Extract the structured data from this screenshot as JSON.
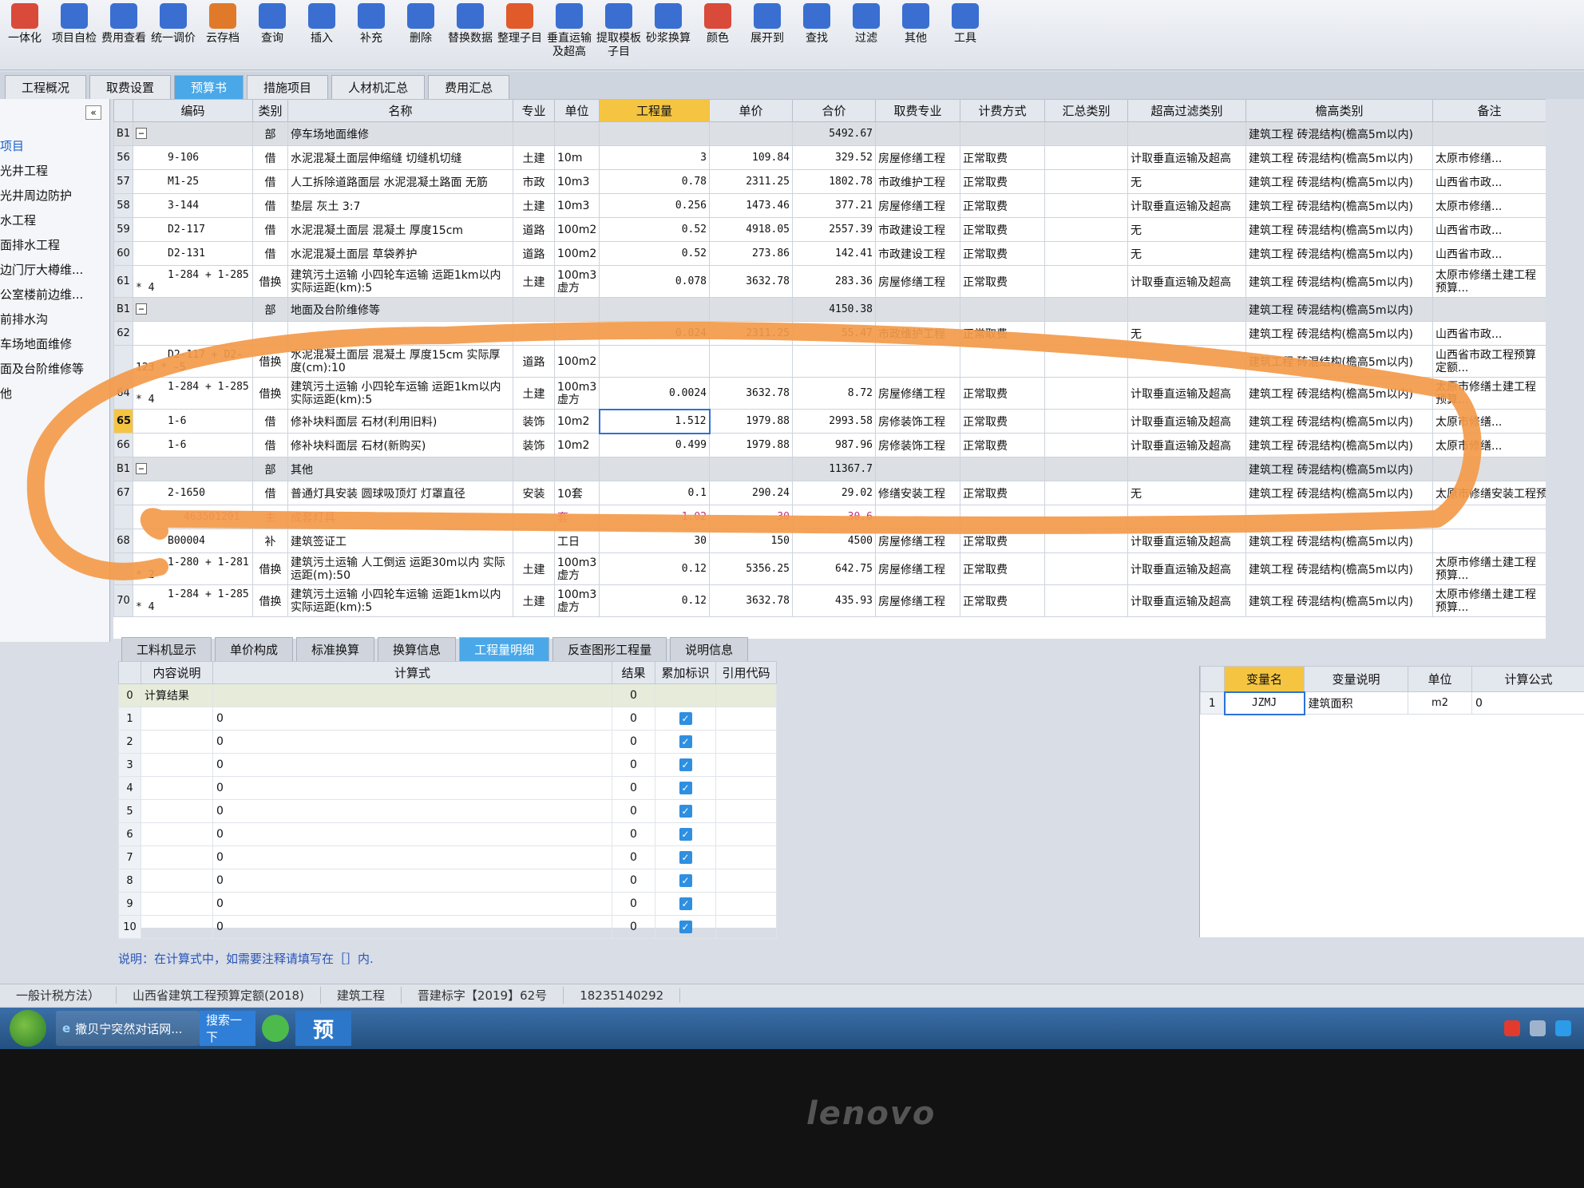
{
  "toolbar": {
    "buttons": [
      {
        "label": "一体化",
        "icon": "integration-icon",
        "color": "#d94a3a"
      },
      {
        "label": "项目自检",
        "icon": "project-check-icon",
        "color": "#3a6fd1"
      },
      {
        "label": "费用查看",
        "icon": "cost-view-icon",
        "color": "#3a6fd1"
      },
      {
        "label": "统一调价",
        "icon": "price-adjust-icon",
        "color": "#3a6fd1"
      },
      {
        "label": "云存档",
        "icon": "cloud-save-icon",
        "color": "#e07a2a"
      },
      {
        "label": "查询",
        "icon": "query-icon",
        "color": "#3a6fd1"
      },
      {
        "label": "插入",
        "icon": "insert-icon",
        "color": "#3a6fd1"
      },
      {
        "label": "补充",
        "icon": "supplement-icon",
        "color": "#3a6fd1"
      },
      {
        "label": "删除",
        "icon": "delete-icon",
        "color": "#3a6fd1"
      },
      {
        "label": "替换数据",
        "icon": "replace-data-icon",
        "color": "#3a6fd1"
      },
      {
        "label": "整理子目",
        "icon": "organize-icon",
        "color": "#e05a2a"
      },
      {
        "label": "垂直运输\n及超高",
        "icon": "vertical-transport-icon",
        "color": "#3a6fd1"
      },
      {
        "label": "提取模板\n子目",
        "icon": "template-icon",
        "color": "#3a6fd1"
      },
      {
        "label": "砂浆换算",
        "icon": "mortar-icon",
        "color": "#3a6fd1"
      },
      {
        "label": "颜色",
        "icon": "color-icon",
        "color": "#d94a3a"
      },
      {
        "label": "展开到",
        "icon": "expand-icon",
        "color": "#3a6fd1"
      },
      {
        "label": "查找",
        "icon": "find-icon",
        "color": "#3a6fd1"
      },
      {
        "label": "过滤",
        "icon": "filter-icon",
        "color": "#3a6fd1"
      },
      {
        "label": "其他",
        "icon": "other-icon",
        "color": "#3a6fd1"
      },
      {
        "label": "工具",
        "icon": "tools-icon",
        "color": "#3a6fd1"
      }
    ]
  },
  "main_tabs": [
    "工程概况",
    "取费设置",
    "预算书",
    "措施项目",
    "人材机汇总",
    "费用汇总"
  ],
  "left_tree": {
    "collapse_label": "«",
    "items": [
      "项目",
      "光井工程",
      "光井周边防护",
      "水工程",
      "面排水工程",
      "边门厅大樽维...",
      "公室楼前边维...",
      "前排水沟",
      "车场地面维修",
      "面及台阶维修等",
      "他"
    ]
  },
  "grid": {
    "headers": [
      "编码",
      "类别",
      "名称",
      "专业",
      "单位",
      "工程量",
      "单价",
      "合价",
      "取费专业",
      "计费方式",
      "汇总类别",
      "超高过滤类别",
      "檐高类别",
      "备注"
    ],
    "rows": [
      {
        "idx": "B1",
        "section": true,
        "code": "",
        "type": "部",
        "name": "停车场地面维修",
        "major": "",
        "unit": "",
        "qty": "",
        "price": "",
        "total": "5492.67",
        "fee": "",
        "method": "",
        "sum": "",
        "filter": "",
        "height": "建筑工程 砖混结构(檐高5m以内)",
        "remark": ""
      },
      {
        "idx": "56",
        "code": "9-106",
        "type": "借",
        "name": "水泥混凝土面层伸缩缝 切缝机切缝",
        "major": "土建",
        "unit": "10m",
        "qty": "3",
        "price": "109.84",
        "total": "329.52",
        "fee": "房屋修缮工程",
        "method": "正常取费",
        "sum": "",
        "filter": "计取垂直运输及超高",
        "height": "建筑工程 砖混结构(檐高5m以内)",
        "remark": "太原市修缮..."
      },
      {
        "idx": "57",
        "code": "M1-25",
        "type": "借",
        "name": "人工拆除道路面层 水泥混凝土路面 无筋",
        "major": "市政",
        "unit": "10m3",
        "qty": "0.78",
        "price": "2311.25",
        "total": "1802.78",
        "fee": "市政维护工程",
        "method": "正常取费",
        "sum": "",
        "filter": "无",
        "height": "建筑工程 砖混结构(檐高5m以内)",
        "remark": "山西省市政..."
      },
      {
        "idx": "58",
        "code": "3-144",
        "type": "借",
        "name": "垫层 灰土 3:7",
        "major": "土建",
        "unit": "10m3",
        "qty": "0.256",
        "price": "1473.46",
        "total": "377.21",
        "fee": "房屋修缮工程",
        "method": "正常取费",
        "sum": "",
        "filter": "计取垂直运输及超高",
        "height": "建筑工程 砖混结构(檐高5m以内)",
        "remark": "太原市修缮..."
      },
      {
        "idx": "59",
        "code": "D2-117",
        "type": "借",
        "name": "水泥混凝土面层 混凝土 厚度15cm",
        "major": "道路",
        "unit": "100m2",
        "qty": "0.52",
        "price": "4918.05",
        "total": "2557.39",
        "fee": "市政建设工程",
        "method": "正常取费",
        "sum": "",
        "filter": "无",
        "height": "建筑工程 砖混结构(檐高5m以内)",
        "remark": "山西省市政..."
      },
      {
        "idx": "60",
        "code": "D2-131",
        "type": "借",
        "name": "水泥混凝土面层 草袋养护",
        "major": "道路",
        "unit": "100m2",
        "qty": "0.52",
        "price": "273.86",
        "total": "142.41",
        "fee": "市政建设工程",
        "method": "正常取费",
        "sum": "",
        "filter": "无",
        "height": "建筑工程 砖混结构(檐高5m以内)",
        "remark": "山西省市政..."
      },
      {
        "idx": "61",
        "tall": true,
        "code": "1-284 + 1-285 * 4",
        "type": "借换",
        "name": "建筑污土运输 小四轮车运输 运距1km以内 实际运距(km):5",
        "major": "土建",
        "unit": "100m3 虚方",
        "qty": "0.078",
        "price": "3632.78",
        "total": "283.36",
        "fee": "房屋修缮工程",
        "method": "正常取费",
        "sum": "",
        "filter": "计取垂直运输及超高",
        "height": "建筑工程 砖混结构(檐高5m以内)",
        "remark": "太原市修缮土建工程预算..."
      },
      {
        "idx": "B1",
        "section": true,
        "code": "",
        "type": "部",
        "name": "地面及台阶维修等",
        "major": "",
        "unit": "",
        "qty": "",
        "price": "",
        "total": "4150.38",
        "fee": "",
        "method": "",
        "sum": "",
        "filter": "",
        "height": "建筑工程 砖混结构(檐高5m以内)",
        "remark": ""
      },
      {
        "idx": "62",
        "code": "",
        "type": "",
        "name": "",
        "major": "",
        "unit": "",
        "qty": "0.024",
        "price": "2311.25",
        "total": "55.47",
        "fee": "市政维护工程",
        "method": "正常取费",
        "sum": "",
        "filter": "无",
        "height": "建筑工程 砖混结构(檐高5m以内)",
        "remark": "山西省市政..."
      },
      {
        "idx": "",
        "tall": true,
        "code": "D2-117 + D2-123 * -5",
        "type": "借换",
        "name": "水泥混凝土面层 混凝土 厚度15cm 实际厚度(cm):10",
        "major": "道路",
        "unit": "100m2",
        "qty": "",
        "price": "",
        "total": "",
        "fee": "",
        "method": "",
        "sum": "",
        "filter": "",
        "height": "建筑工程 砖混结构(檐高5m以内)",
        "remark": "山西省市政工程预算定额..."
      },
      {
        "idx": "64",
        "tall": true,
        "code": "1-284 + 1-285 * 4",
        "type": "借换",
        "name": "建筑污土运输 小四轮车运输 运距1km以内 实际运距(km):5",
        "major": "土建",
        "unit": "100m3 虚方",
        "qty": "0.0024",
        "price": "3632.78",
        "total": "8.72",
        "fee": "房屋修缮工程",
        "method": "正常取费",
        "sum": "",
        "filter": "计取垂直运输及超高",
        "height": "建筑工程 砖混结构(檐高5m以内)",
        "remark": "太原市修缮土建工程预算..."
      },
      {
        "idx": "65",
        "selected": true,
        "code": "1-6",
        "type": "借",
        "name": "修补块料面层 石材(利用旧料)",
        "major": "装饰",
        "unit": "10m2",
        "qty": "1.512",
        "price": "1979.88",
        "total": "2993.58",
        "fee": "房修装饰工程",
        "method": "正常取费",
        "sum": "",
        "filter": "计取垂直运输及超高",
        "height": "建筑工程 砖混结构(檐高5m以内)",
        "remark": "太原市修缮..."
      },
      {
        "idx": "66",
        "code": "1-6",
        "type": "借",
        "name": "修补块料面层 石材(新购买)",
        "major": "装饰",
        "unit": "10m2",
        "qty": "0.499",
        "price": "1979.88",
        "total": "987.96",
        "fee": "房修装饰工程",
        "method": "正常取费",
        "sum": "",
        "filter": "计取垂直运输及超高",
        "height": "建筑工程 砖混结构(檐高5m以内)",
        "remark": "太原市修缮..."
      },
      {
        "idx": "B1",
        "section": true,
        "code": "",
        "type": "部",
        "name": "其他",
        "major": "",
        "unit": "",
        "qty": "",
        "price": "",
        "total": "11367.7",
        "fee": "",
        "method": "",
        "sum": "",
        "filter": "",
        "height": "建筑工程 砖混结构(檐高5m以内)",
        "remark": ""
      },
      {
        "idx": "67",
        "code": "2-1650",
        "type": "借",
        "name": "普通灯具安装 圆球吸顶灯 灯罩直径",
        "major": "安装",
        "unit": "10套",
        "qty": "0.1",
        "price": "290.24",
        "total": "29.02",
        "fee": "修缮安装工程",
        "method": "正常取费",
        "sum": "",
        "filter": "无",
        "height": "建筑工程 砖混结构(檐高5m以内)",
        "remark": "太原市修缮安装工程预算..."
      },
      {
        "idx": "",
        "sub": true,
        "code": "463501201",
        "type": "主",
        "name": "成套灯具",
        "major": "",
        "unit": "套",
        "qty": "1.02",
        "price": "30",
        "total": "30.6",
        "fee": "",
        "method": "",
        "sum": "",
        "filter": "",
        "height": "",
        "remark": ""
      },
      {
        "idx": "68",
        "code": "B00004",
        "type": "补",
        "name": "建筑签证工",
        "major": "",
        "unit": "工日",
        "qty": "30",
        "price": "150",
        "total": "4500",
        "fee": "房屋修缮工程",
        "method": "正常取费",
        "sum": "",
        "filter": "计取垂直运输及超高",
        "height": "建筑工程 砖混结构(檐高5m以内)",
        "remark": ""
      },
      {
        "idx": "",
        "tall": true,
        "code": "1-280 + 1-281 * 2",
        "type": "借换",
        "name": "建筑污土运输 人工倒运 运距30m以内 实际运距(m):50",
        "major": "土建",
        "unit": "100m3 虚方",
        "qty": "0.12",
        "price": "5356.25",
        "total": "642.75",
        "fee": "房屋修缮工程",
        "method": "正常取费",
        "sum": "",
        "filter": "计取垂直运输及超高",
        "height": "建筑工程 砖混结构(檐高5m以内)",
        "remark": "太原市修缮土建工程预算..."
      },
      {
        "idx": "70",
        "tall": true,
        "code": "1-284 + 1-285 * 4",
        "type": "借换",
        "name": "建筑污土运输 小四轮车运输 运距1km以内 实际运距(km):5",
        "major": "土建",
        "unit": "100m3 虚方",
        "qty": "0.12",
        "price": "3632.78",
        "total": "435.93",
        "fee": "房屋修缮工程",
        "method": "正常取费",
        "sum": "",
        "filter": "计取垂直运输及超高",
        "height": "建筑工程 砖混结构(檐高5m以内)",
        "remark": "太原市修缮土建工程预算..."
      }
    ]
  },
  "bottom_tabs": [
    "工料机显示",
    "单价构成",
    "标准换算",
    "换算信息",
    "工程量明细",
    "反查图形工程量",
    "说明信息"
  ],
  "calc_grid": {
    "headers": [
      "内容说明",
      "计算式",
      "结果",
      "累加标识",
      "引用代码"
    ],
    "rows": [
      {
        "idx": "0",
        "desc": "计算结果",
        "formula": "",
        "result": "0",
        "check": false
      },
      {
        "idx": "1",
        "desc": "",
        "formula": "0",
        "result": "0",
        "check": true
      },
      {
        "idx": "2",
        "desc": "",
        "formula": "0",
        "result": "0",
        "check": true
      },
      {
        "idx": "3",
        "desc": "",
        "formula": "0",
        "result": "0",
        "check": true
      },
      {
        "idx": "4",
        "desc": "",
        "formula": "0",
        "result": "0",
        "check": true
      },
      {
        "idx": "5",
        "desc": "",
        "formula": "0",
        "result": "0",
        "check": true
      },
      {
        "idx": "6",
        "desc": "",
        "formula": "0",
        "result": "0",
        "check": true
      },
      {
        "idx": "7",
        "desc": "",
        "formula": "0",
        "result": "0",
        "check": true
      },
      {
        "idx": "8",
        "desc": "",
        "formula": "0",
        "result": "0",
        "check": true
      },
      {
        "idx": "9",
        "desc": "",
        "formula": "0",
        "result": "0",
        "check": true
      },
      {
        "idx": "10",
        "desc": "",
        "formula": "0",
        "result": "0",
        "check": true
      }
    ],
    "note": "说明：在计算式中，如需要注释请填写在［］内."
  },
  "vars_grid": {
    "headers": [
      "变量名",
      "变量说明",
      "单位",
      "计算公式"
    ],
    "rows": [
      {
        "idx": "1",
        "name": "JZMJ",
        "desc": "建筑面积",
        "unit": "m2",
        "formula": "0"
      }
    ]
  },
  "status": {
    "items": [
      "一般计税方法）",
      "山西省建筑工程预算定额(2018)",
      "建筑工程",
      "晋建标字【2019】62号",
      "18235140292"
    ]
  },
  "taskbar": {
    "ie_label": "撒贝宁突然对话网...",
    "search_label": "搜索一下",
    "app_label": "预"
  },
  "monitor": {
    "brand": "lenovo"
  },
  "colors": {
    "accent_tab": "#4aa8e8",
    "highlight_header": "#f5c542",
    "marker": "#f39a4a",
    "checkbox": "#2f8fe0"
  }
}
